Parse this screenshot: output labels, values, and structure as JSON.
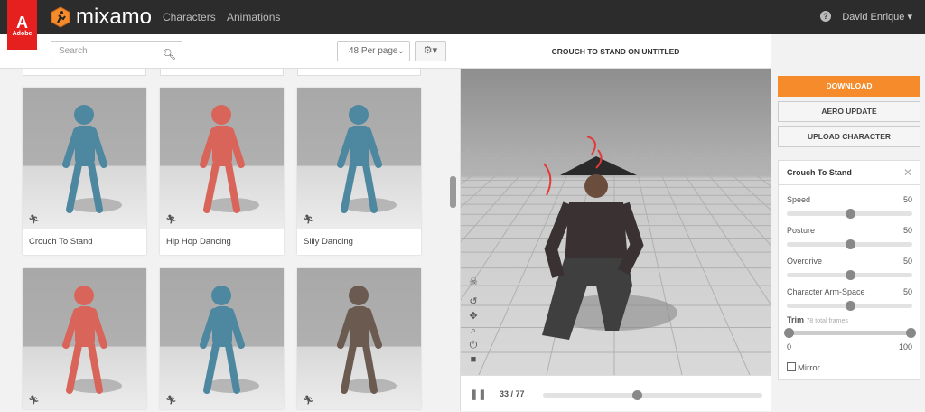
{
  "header": {
    "adobe_label": "Adobe",
    "brand": "mixamo",
    "nav": [
      "Characters",
      "Animations"
    ],
    "help": "?",
    "user": "David Enrique"
  },
  "toolbar": {
    "search_placeholder": "Search",
    "per_page": "48 Per page"
  },
  "cards": [
    {
      "label": "Crouch To Stand",
      "color": "#4d88a0"
    },
    {
      "label": "Hip Hop Dancing",
      "color": "#d9655a"
    },
    {
      "label": "Silly Dancing",
      "color": "#4d88a0"
    },
    {
      "label": "",
      "color": "#d9655a"
    },
    {
      "label": "",
      "color": "#4d88a0"
    },
    {
      "label": "",
      "color": "#6a5a50"
    }
  ],
  "viewer": {
    "title": "CROUCH TO STAND ON UNTITLED",
    "current_frame": "33",
    "total_frames": "77",
    "frame_sep": " / ",
    "progress": 0.43
  },
  "sidebar": {
    "download": "DOWNLOAD",
    "aero": "AERO UPDATE",
    "upload": "UPLOAD CHARACTER",
    "panel_title": "Crouch To Stand",
    "params": [
      {
        "label": "Speed",
        "value": "50",
        "fraction": 0.5
      },
      {
        "label": "Posture",
        "value": "50",
        "fraction": 0.5
      },
      {
        "label": "Overdrive",
        "value": "50",
        "fraction": 0.5
      },
      {
        "label": "Character Arm-Space",
        "value": "50",
        "fraction": 0.5
      }
    ],
    "trim_label": "Trim",
    "trim_note": "78 total frames",
    "trim_min": "0",
    "trim_max": "100",
    "mirror": "Mirror"
  },
  "colors": {
    "accent": "#f58b2a",
    "adobe": "#e5201f"
  }
}
